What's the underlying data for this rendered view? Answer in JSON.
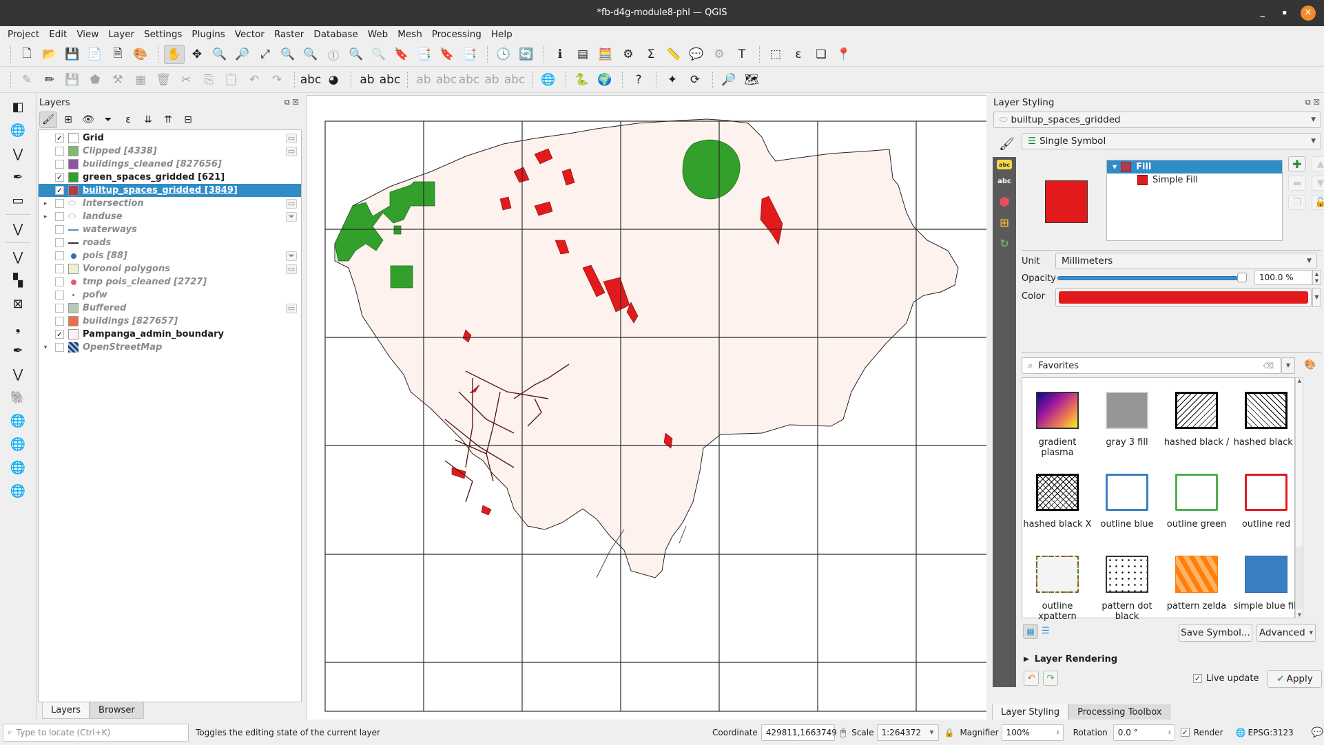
{
  "window": {
    "title": "*fb-d4g-module8-phl — QGIS",
    "minimize": "_",
    "maximize": "▪",
    "close": "✕"
  },
  "menu": [
    "Project",
    "Edit",
    "View",
    "Layer",
    "Settings",
    "Plugins",
    "Vector",
    "Raster",
    "Database",
    "Web",
    "Mesh",
    "Processing",
    "Help"
  ],
  "toolbar1": [
    "new-project-icon",
    "open-project-icon",
    "save-project-icon",
    "new-print-layout-icon",
    "layout-manager-icon",
    "style-manager-icon",
    "pan-icon",
    "pan-to-selection-icon",
    "zoom-in-icon",
    "zoom-out-icon",
    "zoom-full-icon",
    "zoom-to-selection-icon",
    "zoom-to-layer-icon",
    "zoom-native-icon",
    "zoom-last-icon",
    "zoom-next-icon",
    "new-bookmark-icon",
    "show-bookmarks-icon",
    "new-spatial-bookmark-icon",
    "show-spatial-bookmarks-icon",
    "temporal-controller-icon",
    "refresh-icon",
    "identify-icon",
    "attribute-table-icon",
    "field-calculator-icon",
    "processing-toolbox-icon",
    "statistical-summary-icon",
    "measure-icon",
    "map-tips-icon",
    "actions-icon",
    "text-annotation-icon",
    "select-features-icon",
    "select-by-expression-icon",
    "deselect-icon",
    "select-by-location-icon"
  ],
  "toolbar2": [
    "edit-all-icon",
    "toggle-editing-icon",
    "save-edits-icon",
    "digitize-icon",
    "vertex-tool-icon",
    "modify-attributes-icon",
    "delete-selected-icon",
    "cut-features-icon",
    "copy-features-icon",
    "paste-features-icon",
    "undo-icon",
    "redo-icon",
    "label-toolbar-icon",
    "diagram-icon",
    "pin-label-icon",
    "show-hide-labels-icon",
    "highlight-pinned-icon",
    "show-label-icon",
    "move-label-icon",
    "rotate-label-icon",
    "change-label-icon",
    "quickmapservices-icon",
    "python-console-icon",
    "globe-icon",
    "help-icon",
    "georeferencer-icon",
    "table-refresh-icon",
    "search-layers-icon",
    "quick-osm-icon"
  ],
  "left_toolbar": [
    "data-source-manager-icon",
    "new-geopackage-icon",
    "new-shapefile-icon",
    "new-temp-scratch-icon",
    "new-virtual-layer-icon",
    "new-spatialite-icon",
    "add-vector-layer-icon",
    "add-raster-layer-icon",
    "add-mesh-layer-icon",
    "add-delimited-text-icon",
    "add-spatialite-icon",
    "add-virtual-layer-icon",
    "add-postgis-icon",
    "add-wms-icon",
    "add-xyz-icon",
    "add-wfs-icon",
    "add-arcgis-icon"
  ],
  "layers_panel": {
    "title": "Layers",
    "tools": [
      "style-panel-icon",
      "add-group-icon",
      "manage-visibility-icon",
      "filter-legend-icon",
      "filter-expression-icon",
      "expand-all-icon",
      "collapse-all-icon",
      "remove-layer-icon"
    ],
    "items": [
      {
        "label": "Grid",
        "checked": true,
        "state": "on",
        "symbol": "#ffffff",
        "indicator": "memory-layer-icon"
      },
      {
        "label": "Clipped [4338]",
        "checked": false,
        "state": "off",
        "symbol": "#7fba6f",
        "indicator": "memory-layer-icon"
      },
      {
        "label": "buildings_cleaned [827656]",
        "checked": false,
        "state": "off",
        "symbol": "#8f53a0",
        "indicator": ""
      },
      {
        "label": "green_spaces_gridded [621]",
        "checked": true,
        "state": "on",
        "symbol": "#33a02c",
        "indicator": ""
      },
      {
        "label": "builtup_spaces_gridded [3849]",
        "checked": true,
        "state": "selected",
        "symbol": "#b13b4e",
        "indicator": ""
      },
      {
        "label": "Intersection",
        "checked": false,
        "state": "off",
        "symbol": "group",
        "expander": "▸",
        "indicator": "memory-layer-icon"
      },
      {
        "label": "landuse",
        "checked": false,
        "state": "off",
        "symbol": "group",
        "expander": "▸",
        "indicator": "filter-icon"
      },
      {
        "label": "waterways",
        "checked": false,
        "state": "off",
        "symbol": "line-blue",
        "indicator": ""
      },
      {
        "label": "roads",
        "checked": false,
        "state": "off",
        "symbol": "line-dark",
        "indicator": ""
      },
      {
        "label": "pois [88]",
        "checked": false,
        "state": "off",
        "symbol": "dot-blue",
        "indicator": "filter-icon"
      },
      {
        "label": "Voronoi polygons",
        "checked": false,
        "state": "off",
        "symbol": "#eef2d2",
        "indicator": "memory-layer-icon"
      },
      {
        "label": "tmp pois_cleaned [2727]",
        "checked": false,
        "state": "off",
        "symbol": "dot-pink",
        "indicator": ""
      },
      {
        "label": "pofw",
        "checked": false,
        "state": "off",
        "symbol": "dot-small",
        "indicator": ""
      },
      {
        "label": "Buffered",
        "checked": false,
        "state": "off",
        "symbol": "#b4cdb5",
        "indicator": "memory-layer-icon"
      },
      {
        "label": "buildings [827657]",
        "checked": false,
        "state": "off",
        "symbol": "#e8714a",
        "indicator": ""
      },
      {
        "label": "Pampanga_admin_boundary",
        "checked": true,
        "state": "on",
        "symbol": "#fdf2ee",
        "indicator": ""
      },
      {
        "label": "OpenStreetMap",
        "checked": false,
        "state": "off",
        "symbol": "raster",
        "expander": "▾",
        "indicator": ""
      }
    ],
    "tabs": [
      "Layers",
      "Browser"
    ]
  },
  "styling": {
    "title": "Layer Styling",
    "layer": "builtup_spaces_gridded",
    "renderer": "Single Symbol",
    "symbol_color": "#e31a1c",
    "tree": {
      "root": "Fill",
      "child": "Simple Fill"
    },
    "unit_label": "Unit",
    "unit": "Millimeters",
    "opacity_label": "Opacity",
    "opacity_value": "100.0 %",
    "opacity_fraction": 1.0,
    "color_label": "Color",
    "search": "Favorites",
    "favorites": [
      {
        "name": "gradient plasma"
      },
      {
        "name": "gray 3 fill"
      },
      {
        "name": "hashed black /"
      },
      {
        "name": "hashed black \\"
      },
      {
        "name": "hashed black X"
      },
      {
        "name": "outline blue"
      },
      {
        "name": "outline green"
      },
      {
        "name": "outline red"
      },
      {
        "name": "outline xpattern"
      },
      {
        "name": "pattern dot black"
      },
      {
        "name": "pattern zelda"
      },
      {
        "name": "simple blue fill"
      }
    ],
    "save_symbol": "Save Symbol...",
    "advanced": "Advanced",
    "layer_rendering": "Layer Rendering",
    "live_update": "Live update",
    "apply": "Apply",
    "tabs": [
      "Layer Styling",
      "Processing Toolbox"
    ]
  },
  "statusbar": {
    "locate_placeholder": "Type to locate (Ctrl+K)",
    "message": "Toggles the editing state of the current layer",
    "coordinate_label": "Coordinate",
    "coordinate": "429811,1663749",
    "scale_label": "Scale",
    "scale": "1:264372",
    "magnifier_label": "Magnifier",
    "magnifier": "100%",
    "rotation_label": "Rotation",
    "rotation": "0.0 °",
    "render_label": "Render",
    "crs": "EPSG:3123"
  }
}
